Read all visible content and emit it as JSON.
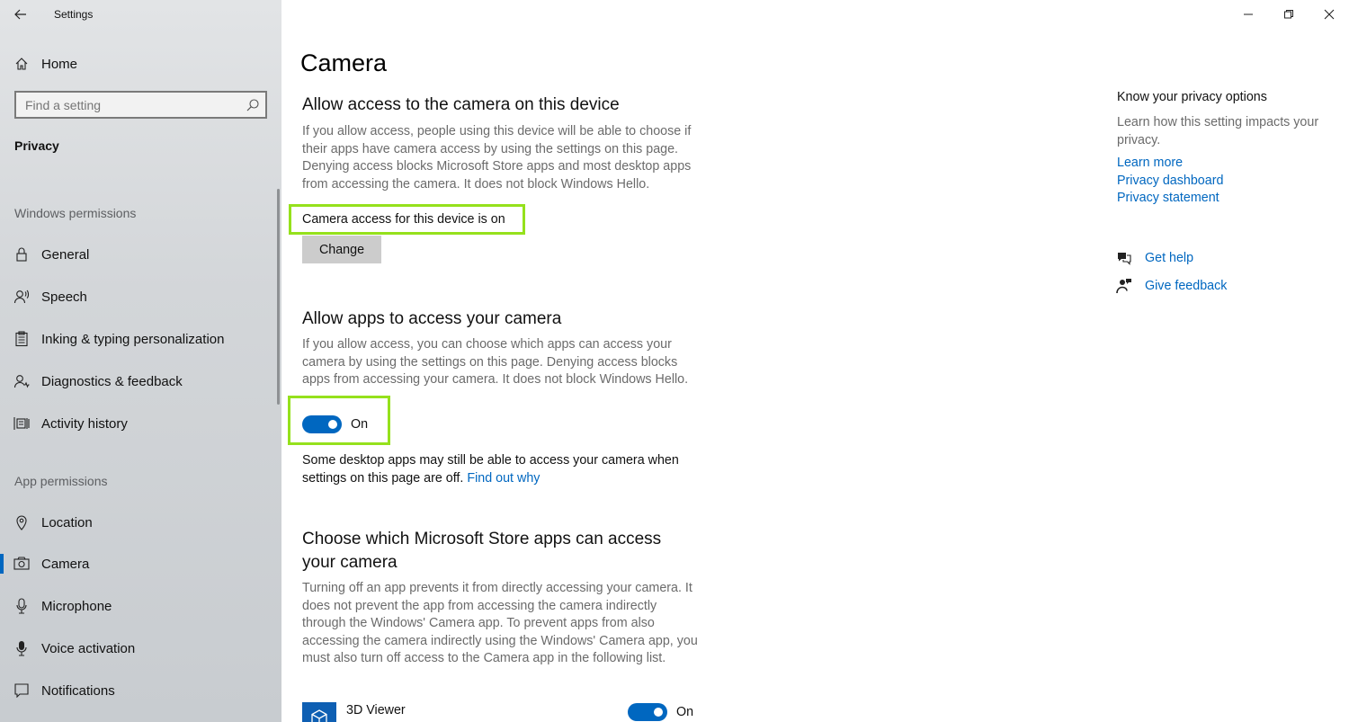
{
  "window": {
    "title": "Settings",
    "back_icon": "back-arrow-icon",
    "controls": [
      "minimize-icon",
      "restore-icon",
      "close-icon"
    ]
  },
  "sidebar": {
    "home_label": "Home",
    "search_placeholder": "Find a setting",
    "section_title": "Privacy",
    "windows_permissions_header": "Windows permissions",
    "windows_permissions": [
      {
        "label": "General",
        "icon": "lock-icon"
      },
      {
        "label": "Speech",
        "icon": "speech-icon"
      },
      {
        "label": "Inking & typing personalization",
        "icon": "clipboard-icon"
      },
      {
        "label": "Diagnostics & feedback",
        "icon": "diagnostics-icon"
      },
      {
        "label": "Activity history",
        "icon": "activity-icon"
      }
    ],
    "app_permissions_header": "App permissions",
    "app_permissions": [
      {
        "label": "Location",
        "icon": "location-icon"
      },
      {
        "label": "Camera",
        "icon": "camera-icon",
        "selected": true
      },
      {
        "label": "Microphone",
        "icon": "microphone-icon"
      },
      {
        "label": "Voice activation",
        "icon": "voice-activation-icon"
      },
      {
        "label": "Notifications",
        "icon": "notifications-icon"
      }
    ]
  },
  "main": {
    "page_title": "Camera",
    "device_access": {
      "heading": "Allow access to the camera on this device",
      "description": "If you allow access, people using this device will be able to choose if their apps have camera access by using the settings on this page. Denying access blocks Microsoft Store apps and most desktop apps from accessing the camera. It does not block Windows Hello.",
      "status": "Camera access for this device is on",
      "change_label": "Change"
    },
    "apps_access": {
      "heading": "Allow apps to access your camera",
      "description": "If you allow access, you can choose which apps can access your camera by using the settings on this page. Denying access blocks apps from accessing your camera. It does not block Windows Hello.",
      "toggle_state": "On",
      "note_text": "Some desktop apps may still be able to access your camera when settings on this page are off.",
      "note_link": "Find out why"
    },
    "store_apps": {
      "heading_line1": "Choose which Microsoft Store apps can access",
      "heading_line2": "your camera",
      "description": "Turning off an app prevents it from directly accessing your camera. It does not prevent the app from accessing the camera indirectly through the Windows' Camera app. To prevent apps from also accessing the camera indirectly using the Windows' Camera app, you must also turn off access to the Camera app in the following list.",
      "apps": [
        {
          "name": "3D Viewer",
          "state": "On",
          "icon": "3d-viewer-icon"
        }
      ]
    }
  },
  "right_panel": {
    "title": "Know your privacy options",
    "description": "Learn how this setting impacts your privacy.",
    "links": [
      "Learn more",
      "Privacy dashboard",
      "Privacy statement"
    ],
    "get_help": "Get help",
    "give_feedback": "Give feedback"
  },
  "colors": {
    "accent": "#0067c0",
    "highlight": "#95e11c"
  }
}
